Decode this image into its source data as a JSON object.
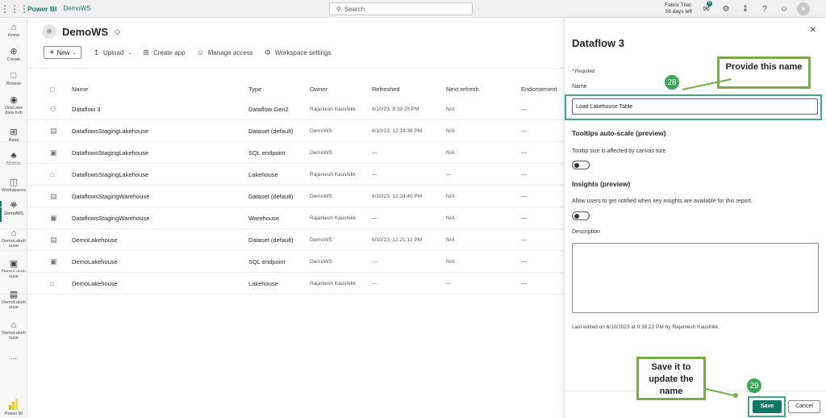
{
  "topbar": {
    "brand": "Power BI",
    "breadcrumb": "DemoWS",
    "search_placeholder": "Search",
    "trial_line1": "Fabric Trial:",
    "trial_line2": "56 days left",
    "notification_count": "6"
  },
  "leftnav": {
    "items": [
      {
        "label": "Home",
        "icon": "home-icon"
      },
      {
        "label": "Create",
        "icon": "plus-circle-icon"
      },
      {
        "label": "Browse",
        "icon": "folder-icon"
      },
      {
        "label": "OneLake data hub",
        "icon": "onelake-icon"
      },
      {
        "label": "Apps",
        "icon": "apps-icon"
      },
      {
        "label": "Metrics",
        "icon": "trophy-icon"
      },
      {
        "label": "Workspaces",
        "icon": "workspaces-icon"
      },
      {
        "label": "DemoWS",
        "icon": "workspace-icon"
      },
      {
        "label": "DemoLakeh ouse",
        "icon": "lakehouse-icon"
      },
      {
        "label": "DemoLakeh ouse",
        "icon": "sql-endpoint-icon"
      },
      {
        "label": "DemoLakeh ouse",
        "icon": "dataset-icon"
      },
      {
        "label": "DemoLakeh ouse",
        "icon": "lakehouse-icon"
      },
      {
        "label": "...",
        "icon": "more-icon"
      }
    ],
    "footer_label": "Power BI"
  },
  "workspace": {
    "title": "DemoWS",
    "toolbar": {
      "new": "New",
      "upload": "Upload",
      "create_app": "Create app",
      "manage_access": "Manage access",
      "workspace_settings": "Workspace settings"
    }
  },
  "table": {
    "headers": [
      "Name",
      "Type",
      "Owner",
      "Refreshed",
      "Next refresh",
      "Endorsement"
    ],
    "rows": [
      {
        "name": "Dataflow 3",
        "type": "Dataflow Gen2",
        "owner": "Rajaniesh Kaushikk",
        "refreshed": "6/10/23, 9:39:25 PM",
        "next": "N/A",
        "endorsement": "—",
        "icon": "dataflow-icon"
      },
      {
        "name": "DataflowsStagingLakehouse",
        "type": "Dataset (default)",
        "owner": "DemoWS",
        "refreshed": "6/10/23, 12:24:38 PM",
        "next": "N/A",
        "endorsement": "—",
        "icon": "dataset-icon"
      },
      {
        "name": "DataflowsStagingLakehouse",
        "type": "SQL endpoint",
        "owner": "DemoWS",
        "refreshed": "—",
        "next": "N/A",
        "endorsement": "—",
        "icon": "sql-endpoint-icon"
      },
      {
        "name": "DataflowsStagingLakehouse",
        "type": "Lakehouse",
        "owner": "Rajaniesh Kaushikk",
        "refreshed": "—",
        "next": "—",
        "endorsement": "—",
        "icon": "lakehouse-icon"
      },
      {
        "name": "DataflowsStagingWarehouse",
        "type": "Dataset (default)",
        "owner": "DemoWS",
        "refreshed": "6/10/23, 12:24:40 PM",
        "next": "N/A",
        "endorsement": "—",
        "icon": "dataset-icon"
      },
      {
        "name": "DataflowsStagingWarehouse",
        "type": "Warehouse",
        "owner": "Rajaniesh Kaushikk",
        "refreshed": "—",
        "next": "N/A",
        "endorsement": "—",
        "icon": "warehouse-icon"
      },
      {
        "name": "DemoLakehouse",
        "type": "Dataset (default)",
        "owner": "DemoWS",
        "refreshed": "6/10/23, 12:21:12 PM",
        "next": "N/A",
        "endorsement": "—",
        "icon": "dataset-icon"
      },
      {
        "name": "DemoLakehouse",
        "type": "SQL endpoint",
        "owner": "DemoWS",
        "refreshed": "—",
        "next": "N/A",
        "endorsement": "—",
        "icon": "sql-endpoint-icon"
      },
      {
        "name": "DemoLakehouse",
        "type": "Lakehouse",
        "owner": "Rajaniesh Kaushikk",
        "refreshed": "—",
        "next": "—",
        "endorsement": "—",
        "icon": "lakehouse-icon"
      }
    ]
  },
  "panel": {
    "title": "Dataflow 3",
    "required": "* Required",
    "name_label": "Name",
    "name_value": "Load Lakehouse Table",
    "tooltips_title": "Tooltips auto-scale (preview)",
    "tooltips_desc": "Tooltip size is affected by canvas size",
    "insights_title": "Insights (preview)",
    "insights_desc": "Allow users to get notified when key insights are available for this report.",
    "description_label": "Description",
    "last_edited": "Last edited on 6/10/2023 at 9:38:22 PM by Rajaniesh Kaushikk",
    "save": "Save",
    "cancel": "Cancel"
  },
  "annotations": {
    "callout1": "Provide this name",
    "badge1": "28",
    "callout2": "Save it to update the name",
    "badge2": "29"
  },
  "colors": {
    "accent": "#117865",
    "annotation_green": "#77a94d",
    "badge_green": "#3aa657"
  }
}
